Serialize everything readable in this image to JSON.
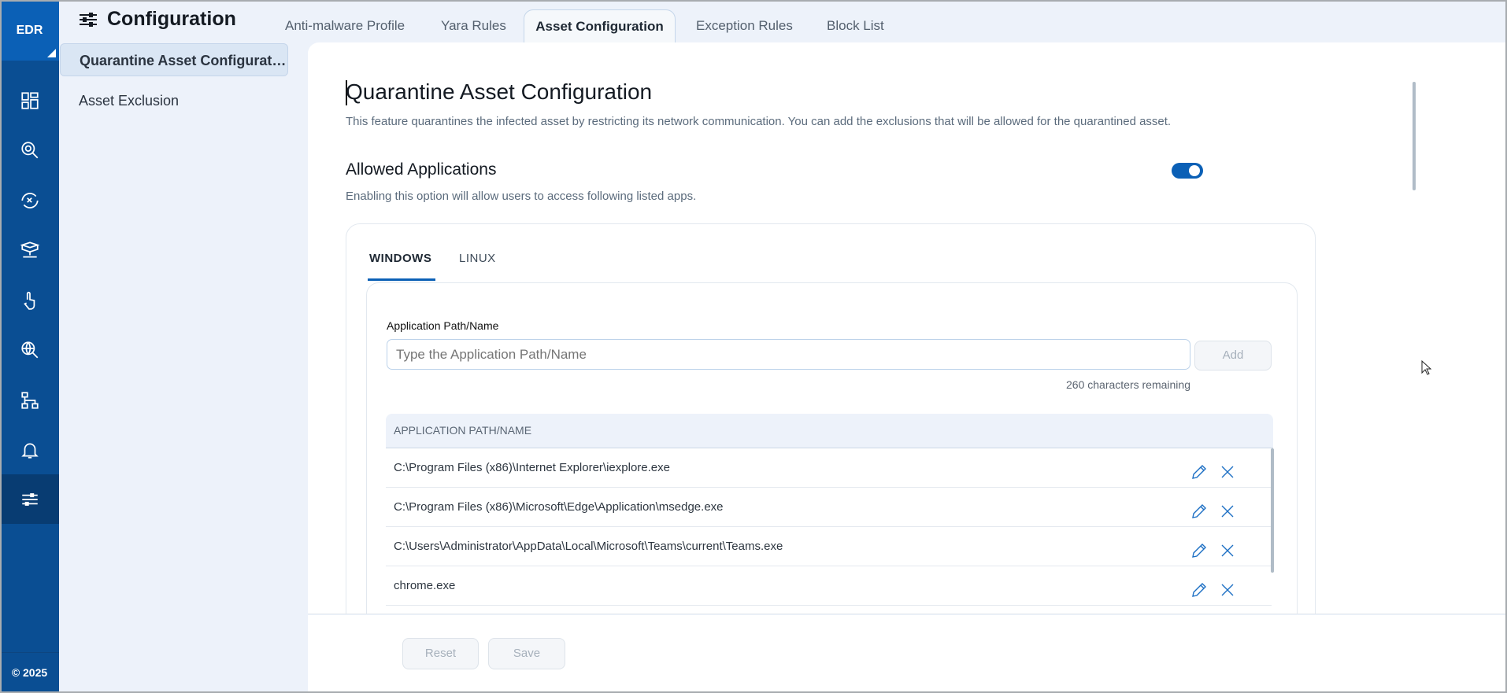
{
  "app": {
    "logo": "EDR",
    "copyright": "© 2025"
  },
  "rail": {
    "icons": [
      "dashboard-icon",
      "threat-search-icon",
      "shield-scan-icon",
      "network-asset-icon",
      "hand-touch-icon",
      "globe-search-icon",
      "hierarchy-icon",
      "bell-icon",
      "sliders-icon"
    ],
    "active": "sliders-icon"
  },
  "header": {
    "title": "Configuration",
    "tabs": [
      "Anti-malware Profile",
      "Yara Rules",
      "Asset Configuration",
      "Exception Rules",
      "Block List"
    ],
    "active_tab": "Asset Configuration"
  },
  "subnav": {
    "items": [
      "Quarantine Asset Configuration",
      "Asset Exclusion"
    ],
    "active": "Quarantine Asset Configuration"
  },
  "main": {
    "title": "Quarantine Asset Configuration",
    "description": "This feature quarantines the infected asset by restricting its network communication. You can add the exclusions that will be allowed for the quarantined asset.",
    "section_title": "Allowed Applications",
    "section_desc": "Enabling this option will allow users to access following listed apps.",
    "toggle_on": true,
    "os_tabs": [
      "WINDOWS",
      "LINUX"
    ],
    "active_os": "WINDOWS",
    "field_label": "Application Path/Name",
    "input_value": "",
    "input_placeholder": "Type the Application Path/Name",
    "add_label": "Add",
    "chars_remaining": "260 characters remaining",
    "table_header": "APPLICATION PATH/NAME",
    "rows": [
      "C:\\Program Files (x86)\\Internet Explorer\\iexplore.exe",
      "C:\\Program Files (x86)\\Microsoft\\Edge\\Application\\msedge.exe",
      "C:\\Users\\Administrator\\AppData\\Local\\Microsoft\\Teams\\current\\Teams.exe",
      "chrome.exe"
    ]
  },
  "footer": {
    "reset": "Reset",
    "save": "Save"
  },
  "colors": {
    "brand": "#0b60b6",
    "rail": "#0a4e93",
    "accent": "#1c6fc4"
  }
}
